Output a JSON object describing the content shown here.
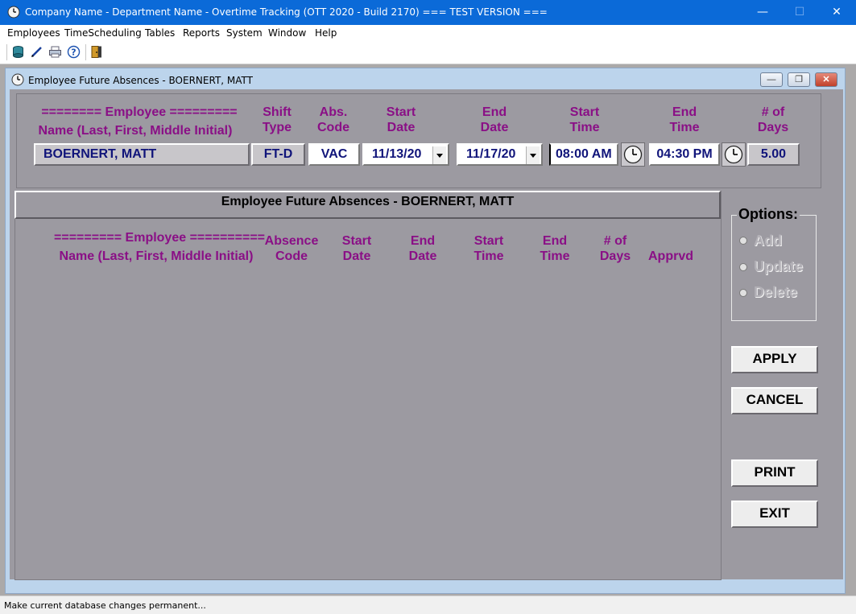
{
  "app": {
    "title": "Company Name - Department Name - Overtime Tracking (OTT 2020 - Build 2170)  === TEST VERSION ===",
    "window_buttons": {
      "minimize": "—",
      "maximize": "☐",
      "close": "✕"
    }
  },
  "menu": [
    "Employees",
    "TimeScheduling",
    "Tables",
    "Reports",
    "System",
    "Window",
    "Help"
  ],
  "toolbar": {
    "icons": [
      "database-icon",
      "pen-icon",
      "printer-icon",
      "help-icon",
      "exit-door-icon"
    ]
  },
  "child_window": {
    "title": "Employee Future Absences - BOERNERT, MATT",
    "buttons": {
      "minimize": "—",
      "restore": "❐",
      "close": "✕"
    }
  },
  "entry": {
    "headers": {
      "employee_line1": "======== Employee =========",
      "employee_line2": "Name (Last, First, Middle Initial)",
      "shift_1": "Shift",
      "shift_2": "Type",
      "abs_1": "Abs.",
      "abs_2": "Code",
      "start_date_1": "Start",
      "start_date_2": "Date",
      "end_date_1": "End",
      "end_date_2": "Date",
      "start_time_1": "Start",
      "start_time_2": "Time",
      "end_time_1": "End",
      "end_time_2": "Time",
      "days_1": "# of",
      "days_2": "Days"
    },
    "values": {
      "employee": "BOERNERT, MATT",
      "shift_type": "FT-D",
      "abs_code": "VAC",
      "start_date": "11/13/20",
      "end_date": "11/17/20",
      "start_time": "08:00 AM",
      "end_time": "04:30 PM",
      "days": "5.00"
    }
  },
  "list": {
    "title": "Employee Future Absences - BOERNERT, MATT",
    "headers": {
      "employee_line1": "========= Employee ==========",
      "employee_line2": "Name (Last, First, Middle Initial)",
      "absence_1": "Absence",
      "absence_2": "Code",
      "start_date_1": "Start",
      "start_date_2": "Date",
      "end_date_1": "End",
      "end_date_2": "Date",
      "start_time_1": "Start",
      "start_time_2": "Time",
      "end_time_1": "End",
      "end_time_2": "Time",
      "days_1": "# of",
      "days_2": "Days",
      "apprvd": "Apprvd"
    },
    "rows": []
  },
  "options": {
    "label": "Options:",
    "items": [
      "Add",
      "Update",
      "Delete"
    ],
    "enabled": false
  },
  "buttons": {
    "apply": "APPLY",
    "cancel": "CANCEL",
    "print": "PRINT",
    "exit": "EXIT"
  },
  "status": "Make current database changes permanent..."
}
